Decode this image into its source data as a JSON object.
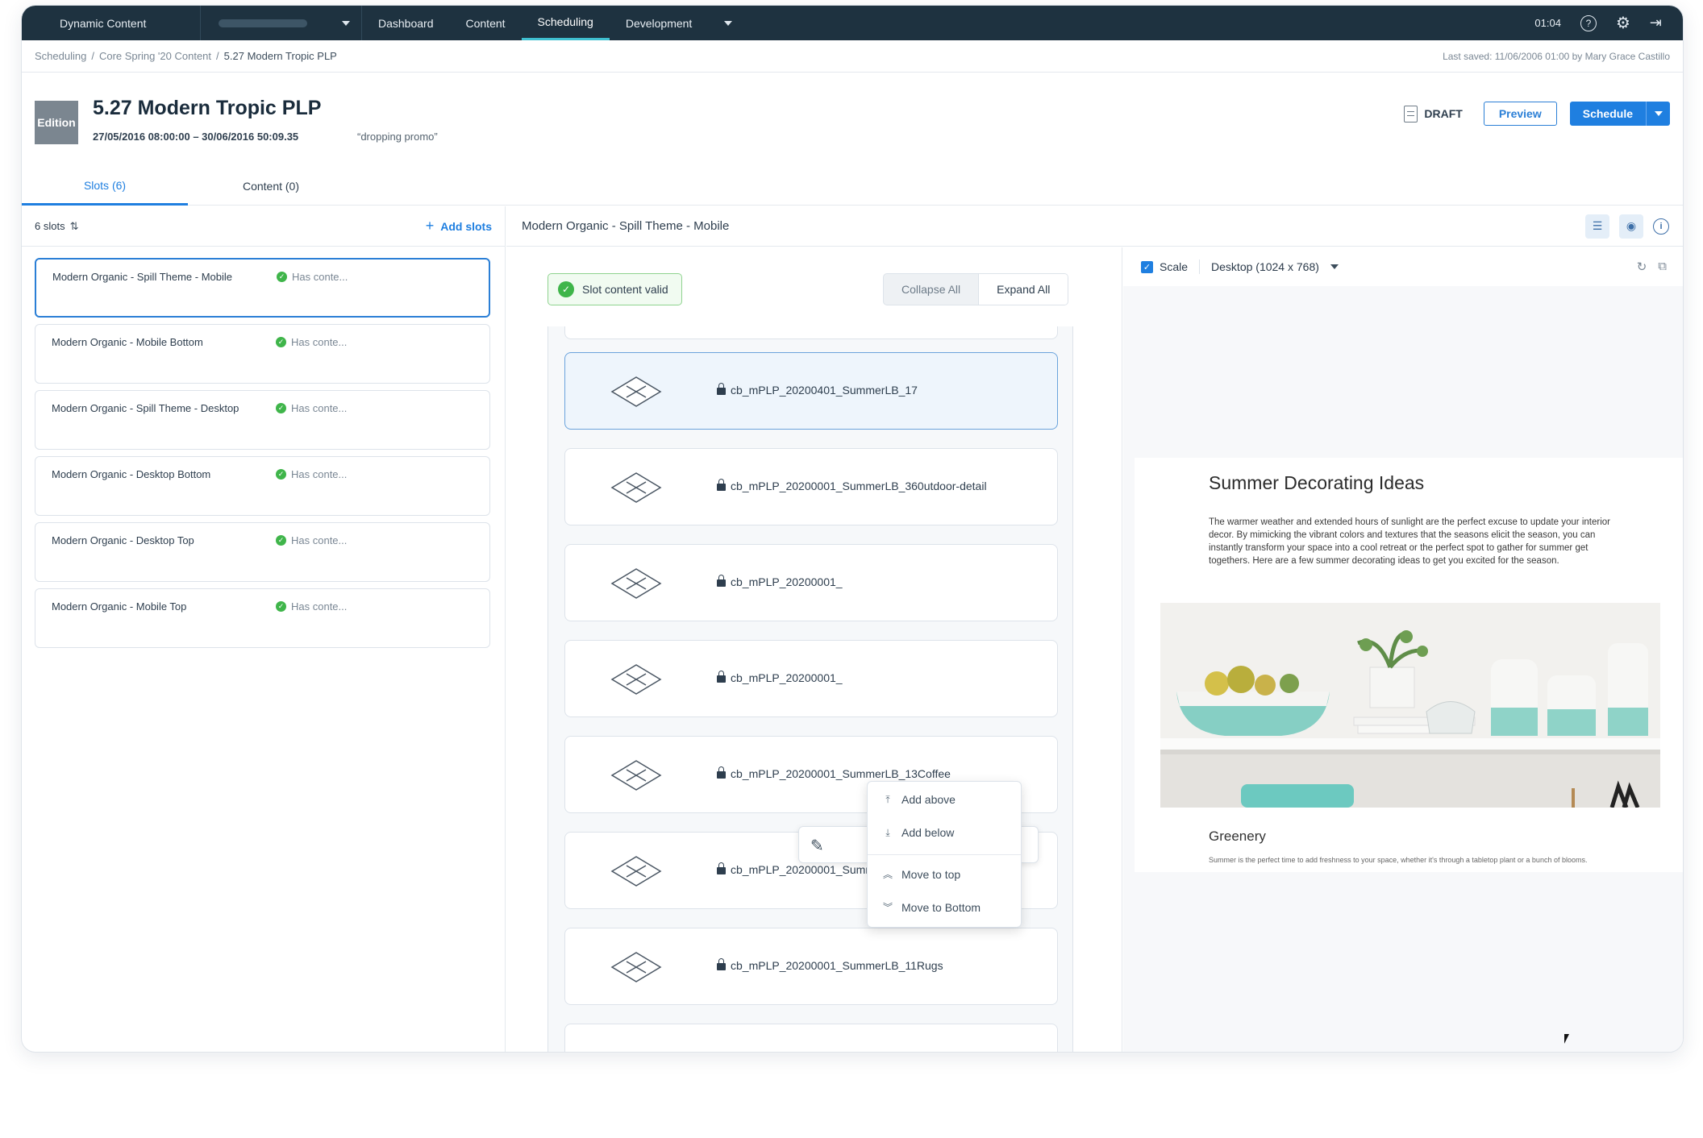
{
  "app": {
    "brand": "Dynamic Content",
    "nav": [
      "Dashboard",
      "Content",
      "Scheduling",
      "Development"
    ],
    "active_nav": "Scheduling",
    "time": "01:04"
  },
  "breadcrumb": {
    "items": [
      "Scheduling",
      "Core Spring '20 Content",
      "5.27 Modern Tropic PLP"
    ],
    "last_saved": "Last saved: 11/06/2006 01:00 by Mary Grace Castillo"
  },
  "edition": {
    "badge": "Edition",
    "title": "5.27 Modern Tropic PLP",
    "dates": "27/05/2016 08:00:00 – 30/06/2016 50:09.35",
    "note": "“dropping promo”",
    "status": "DRAFT",
    "preview_label": "Preview",
    "schedule_label": "Schedule"
  },
  "tabs": [
    "Slots (6)",
    "Content (0)"
  ],
  "slots_panel": {
    "count_label": "6 slots",
    "add_label": "Add slots",
    "items": [
      {
        "name": "Modern Organic - Spill Theme - Mobile",
        "status": "Has conte..."
      },
      {
        "name": "Modern Organic - Mobile Bottom",
        "status": "Has conte..."
      },
      {
        "name": "Modern Organic - Spill Theme - Desktop",
        "status": "Has conte..."
      },
      {
        "name": "Modern Organic - Desktop Bottom",
        "status": "Has conte..."
      },
      {
        "name": "Modern Organic - Desktop Top",
        "status": "Has conte..."
      },
      {
        "name": "Modern Organic - Mobile Top",
        "status": "Has conte..."
      }
    ]
  },
  "editor": {
    "slot_title": "Modern Organic - Spill Theme - Mobile",
    "valid_label": "Slot content valid",
    "collapse_label": "Collapse All",
    "expand_label": "Expand All",
    "blocks": [
      "cb_mPLP_20200401_SummerLB_17",
      "cb_mPLP_20200001_SummerLB_360utdoor-detail",
      "cb_mPLP_20200001_",
      "cb_mPLP_20200001_",
      "cb_mPLP_20200001_SummerLB_13Coffee",
      "cb_mPLP_20200001_SummerLB_12Rugs-detail",
      "cb_mPLP_20200001_SummerLB_11Rugs"
    ],
    "context_menu": [
      "Add above",
      "Add below",
      "Move to top",
      "Move to Bottom"
    ]
  },
  "preview": {
    "scale_label": "Scale",
    "device": "Desktop (1024 x 768)",
    "heading": "Summer Decorating Ideas",
    "body": "The warmer weather and extended hours of sunlight are the perfect excuse to update your interior decor. By mimicking the vibrant colors and textures that the seasons elicit the season, you can instantly transform your space into a cool retreat or the perfect spot to gather for summer get togethers. Here are a few summer decorating ideas to get you excited for the season.",
    "subheading": "Greenery",
    "small": "Summer is the perfect time to add freshness to your space, whether it's through a tabletop plant or a bunch of blooms."
  }
}
